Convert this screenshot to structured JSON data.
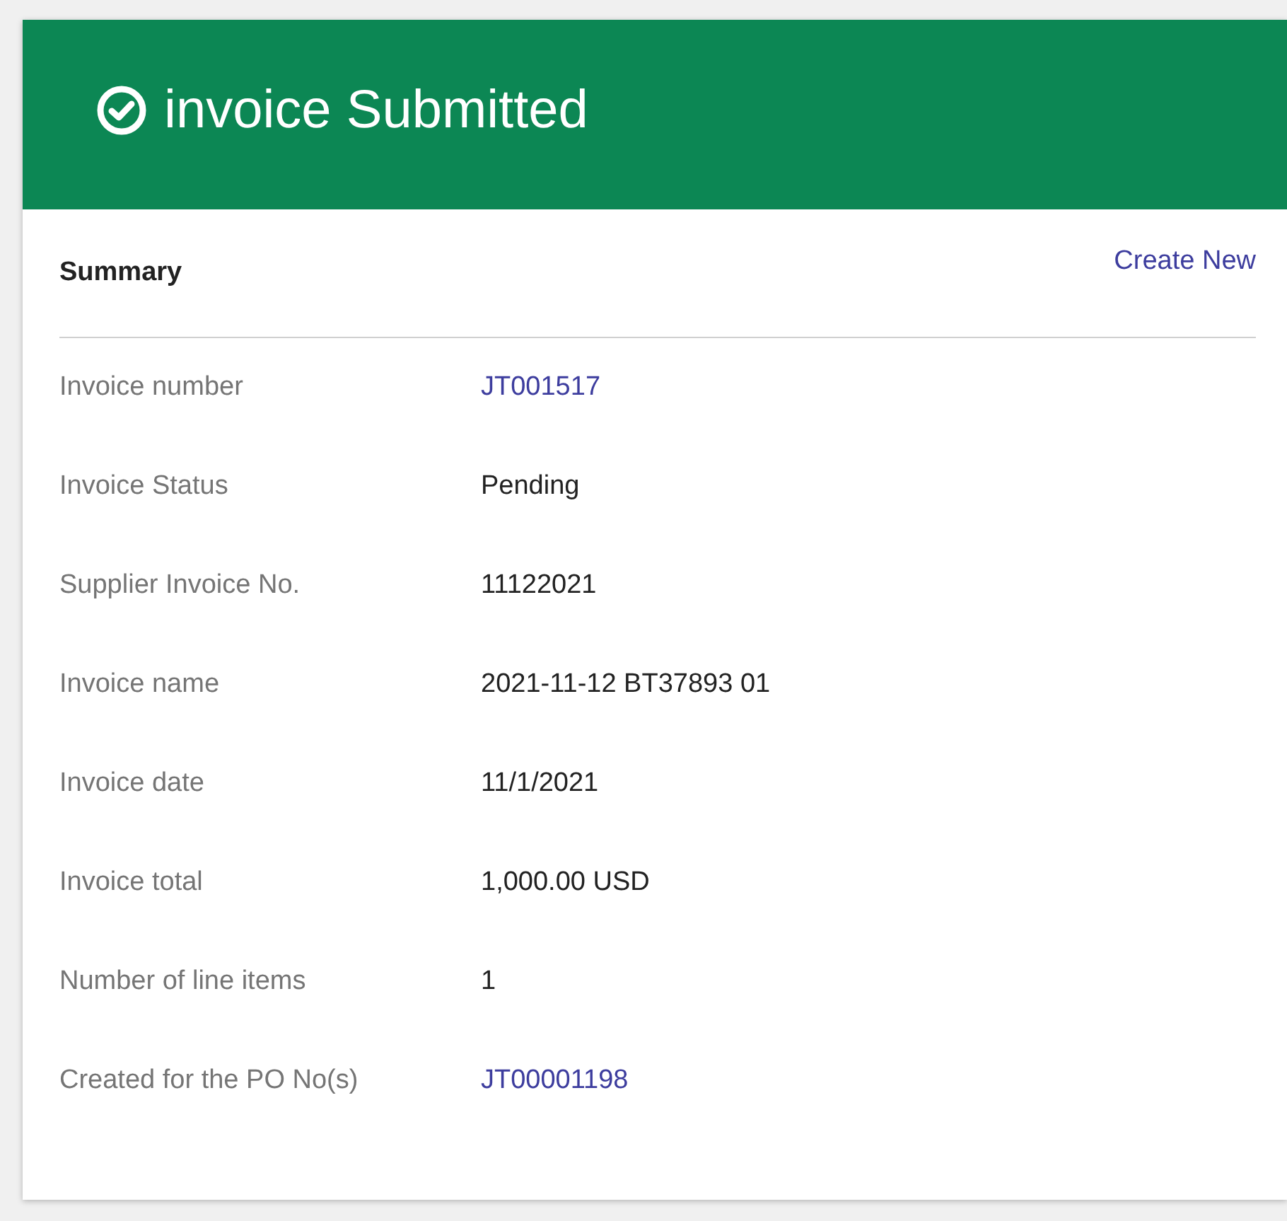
{
  "header": {
    "title": "invoice Submitted"
  },
  "summary": {
    "heading": "Summary",
    "action": "Create New"
  },
  "fields": [
    {
      "label": "Invoice number",
      "value": "JT001517",
      "kind": "link"
    },
    {
      "label": "Invoice Status",
      "value": "Pending",
      "kind": "text"
    },
    {
      "label": "Supplier Invoice No.",
      "value": "11122021",
      "kind": "text"
    },
    {
      "label": "Invoice name",
      "value": "2021-11-12 BT37893 01",
      "kind": "text"
    },
    {
      "label": "Invoice date",
      "value": "11/1/2021",
      "kind": "text"
    },
    {
      "label": "Invoice total",
      "value": "1,000.00 USD",
      "kind": "text"
    },
    {
      "label": "Number of line items",
      "value": "1",
      "kind": "text"
    },
    {
      "label": "Created for the PO No(s)",
      "value": "JT00001198",
      "kind": "link"
    }
  ]
}
